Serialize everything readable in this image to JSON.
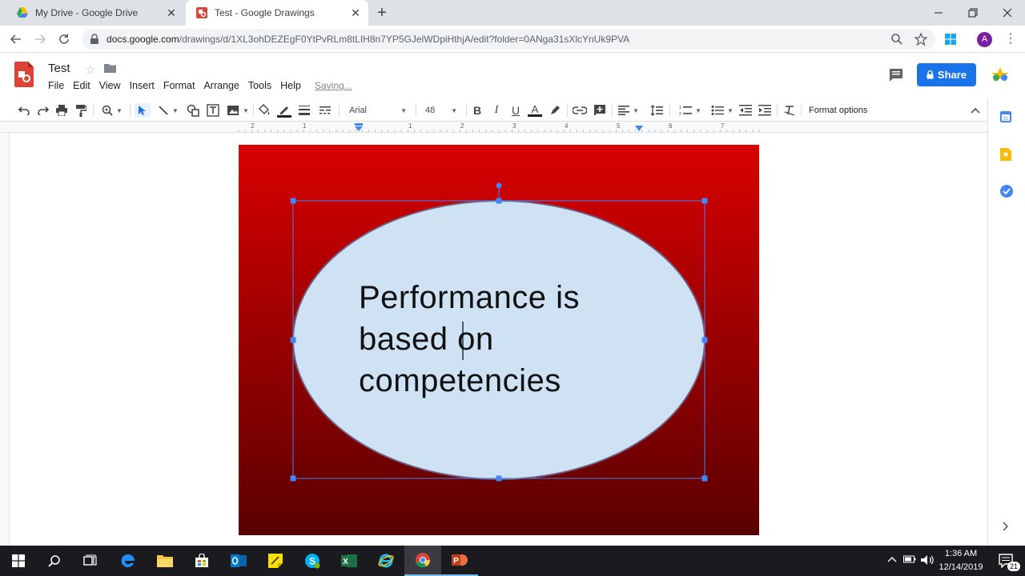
{
  "browser": {
    "tabs": [
      {
        "title": "My Drive - Google Drive",
        "active": false
      },
      {
        "title": "Test - Google Drawings",
        "active": true
      }
    ],
    "url_host": "docs.google.com",
    "url_path": "/drawings/d/1XL3ohDEZEgF0YtPvRLm8tLIH8n7YP5GJelWDpiHthjA/edit?folder=0ANga31sXlcYnUk9PVA",
    "profile_initial": "A"
  },
  "doc": {
    "title": "Test",
    "menu": [
      "File",
      "Edit",
      "View",
      "Insert",
      "Format",
      "Arrange",
      "Tools",
      "Help"
    ],
    "status": "Saving...",
    "share_label": "Share"
  },
  "toolbar": {
    "font": "Arial",
    "font_size": "48",
    "format_options": "Format options",
    "underline_color": "#d50000"
  },
  "ruler": {
    "h_labels": [
      "2",
      "1",
      "1",
      "2",
      "3",
      "4",
      "5",
      "6",
      "7"
    ]
  },
  "drawing": {
    "background_top": "#d80000",
    "background_bottom": "#5a0000",
    "ellipse_fill": "#cfe2f3",
    "text_lines": [
      "Performance is",
      "based on",
      "competencies"
    ]
  },
  "taskbar": {
    "time": "1:36 AM",
    "date": "12/14/2019",
    "notification_count": "21"
  },
  "colors": {
    "accent_blue": "#1a73e8",
    "selection_blue": "#4285f4"
  }
}
